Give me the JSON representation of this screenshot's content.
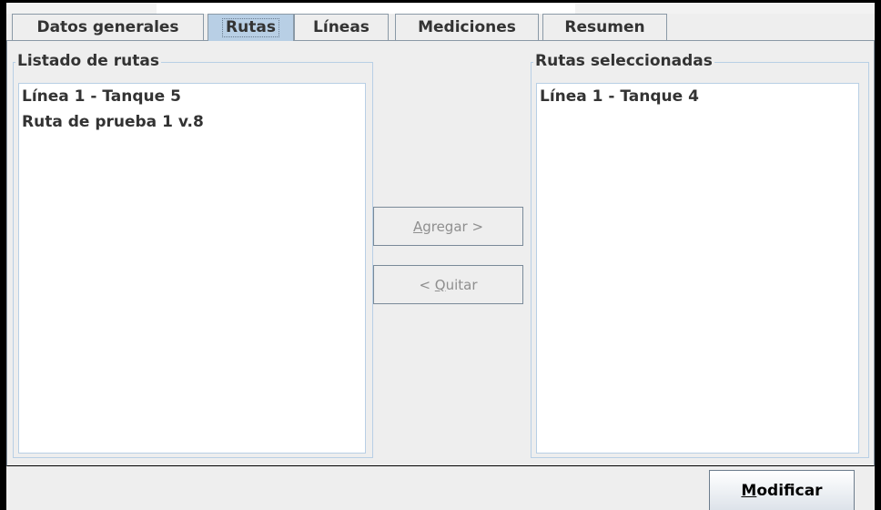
{
  "tabs": [
    {
      "label": "Datos generales",
      "selected": false
    },
    {
      "label": "Rutas",
      "selected": true
    },
    {
      "label": "Líneas",
      "selected": false
    },
    {
      "label": "Mediciones",
      "selected": false
    },
    {
      "label": "Resumen",
      "selected": false
    }
  ],
  "available_routes": {
    "title": "Listado de rutas",
    "items": [
      "Línea 1 - Tanque 5",
      "Ruta de prueba 1 v.8"
    ]
  },
  "selected_routes": {
    "title": "Rutas seleccionadas",
    "items": [
      "Línea 1 - Tanque 4"
    ]
  },
  "buttons": {
    "add": {
      "mnemonic": "A",
      "rest": "gregar >",
      "enabled": false
    },
    "remove": {
      "prefix": "< ",
      "mnemonic": "Q",
      "rest": "uitar",
      "enabled": false
    },
    "modify": {
      "mnemonic": "M",
      "rest": "odificar",
      "enabled": true
    }
  },
  "colors": {
    "selected_tab": "#b8cfe5",
    "border": "#8a99a6",
    "list_background": "#ffffff",
    "disabled_text": "#8f8f8f"
  }
}
